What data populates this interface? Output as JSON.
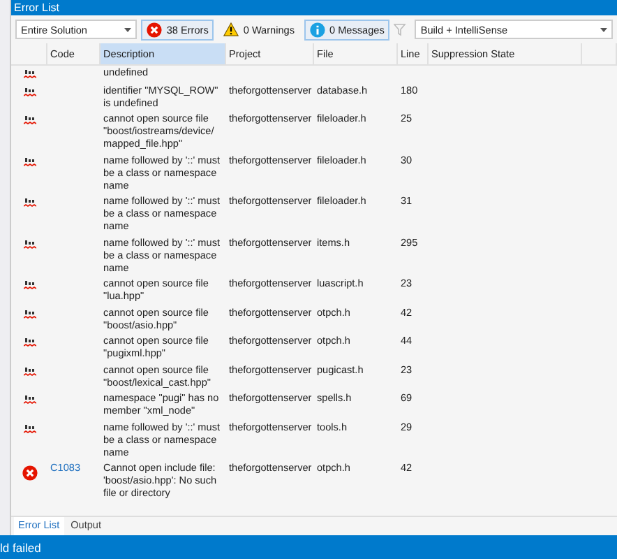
{
  "window": {
    "title": "Error List"
  },
  "toolbar": {
    "scope": "Entire Solution",
    "filters": [
      {
        "kind": "error",
        "label": "38 Errors",
        "selected": true
      },
      {
        "kind": "warning",
        "label": "0 Warnings",
        "selected": false
      },
      {
        "kind": "info",
        "label": "0 Messages",
        "selected": true
      }
    ],
    "source": "Build + IntelliSense"
  },
  "table": {
    "columns": [
      "Code",
      "Description",
      "Project",
      "File",
      "Line",
      "Suppression State"
    ],
    "rows": [
      {
        "kind": "intellisense",
        "description": "undefined"
      },
      {
        "kind": "intellisense",
        "description": "identifier \"MYSQL_ROW\" is undefined",
        "project": "theforgottenserver",
        "file": "database.h",
        "line": "180"
      },
      {
        "kind": "intellisense",
        "description": "cannot open source file \"boost/iostreams/device/ mapped_file.hpp\"",
        "project": "theforgottenserver",
        "file": "fileloader.h",
        "line": "25"
      },
      {
        "kind": "intellisense",
        "description": "name followed by '::' must be a class or namespace name",
        "project": "theforgottenserver",
        "file": "fileloader.h",
        "line": "30"
      },
      {
        "kind": "intellisense",
        "description": "name followed by '::' must be a class or namespace name",
        "project": "theforgottenserver",
        "file": "fileloader.h",
        "line": "31"
      },
      {
        "kind": "intellisense",
        "description": "name followed by '::' must be a class or namespace name",
        "project": "theforgottenserver",
        "file": "items.h",
        "line": "295"
      },
      {
        "kind": "intellisense",
        "description": "cannot open source file \"lua.hpp\"",
        "project": "theforgottenserver",
        "file": "luascript.h",
        "line": "23"
      },
      {
        "kind": "intellisense",
        "description": "cannot open source file \"boost/asio.hpp\"",
        "project": "theforgottenserver",
        "file": "otpch.h",
        "line": "42"
      },
      {
        "kind": "intellisense",
        "description": "cannot open source file \"pugixml.hpp\"",
        "project": "theforgottenserver",
        "file": "otpch.h",
        "line": "44"
      },
      {
        "kind": "intellisense",
        "description": "cannot open source file \"boost/lexical_cast.hpp\"",
        "project": "theforgottenserver",
        "file": "pugicast.h",
        "line": "23"
      },
      {
        "kind": "intellisense",
        "description": "namespace \"pugi\" has no member \"xml_node\"",
        "project": "theforgottenserver",
        "file": "spells.h",
        "line": "69"
      },
      {
        "kind": "intellisense",
        "description": "name followed by '::' must be a class or namespace name",
        "project": "theforgottenserver",
        "file": "tools.h",
        "line": "29"
      },
      {
        "kind": "build",
        "code": "C1083",
        "description": "Cannot open include file: 'boost/asio.hpp': No such file or directory",
        "project": "theforgottenserver",
        "file": "otpch.h",
        "line": "42"
      }
    ]
  },
  "tabs": [
    {
      "label": "Error List",
      "selected": true
    },
    {
      "label": "Output",
      "selected": false
    }
  ],
  "status_bar": "ld failed"
}
